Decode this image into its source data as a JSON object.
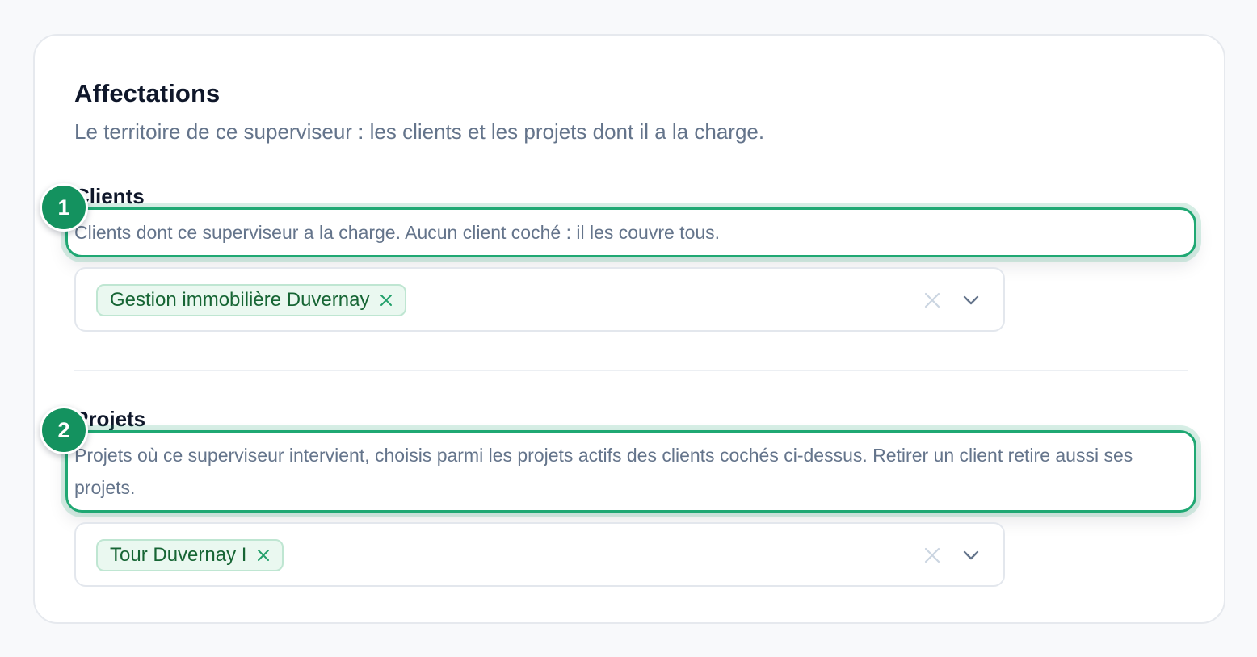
{
  "section": {
    "title": "Affectations",
    "description": "Le territoire de ce superviseur : les clients et les projets dont il a la charge."
  },
  "clients": {
    "label": "Clients",
    "help": "Clients dont ce superviseur a la charge. Aucun client coché : il les couvre tous.",
    "badge": "1",
    "selected": [
      "Gestion immobilière Duvernay"
    ]
  },
  "projects": {
    "label": "Projets",
    "help": "Projets où ce superviseur intervient, choisis parmi les projets actifs des clients cochés ci-dessus. Retirer un client retire aussi ses projets.",
    "badge": "2",
    "selected": [
      "Tour Duvernay I"
    ]
  },
  "icons": {
    "chip_remove": "x-icon",
    "clear": "clear-x-icon",
    "dropdown": "chevron-down-icon"
  },
  "colors": {
    "accent": "#1fa873",
    "badge": "#14925f",
    "chip_bg": "#eaf8f0",
    "chip_text": "#166534",
    "muted_text": "#64748b"
  }
}
